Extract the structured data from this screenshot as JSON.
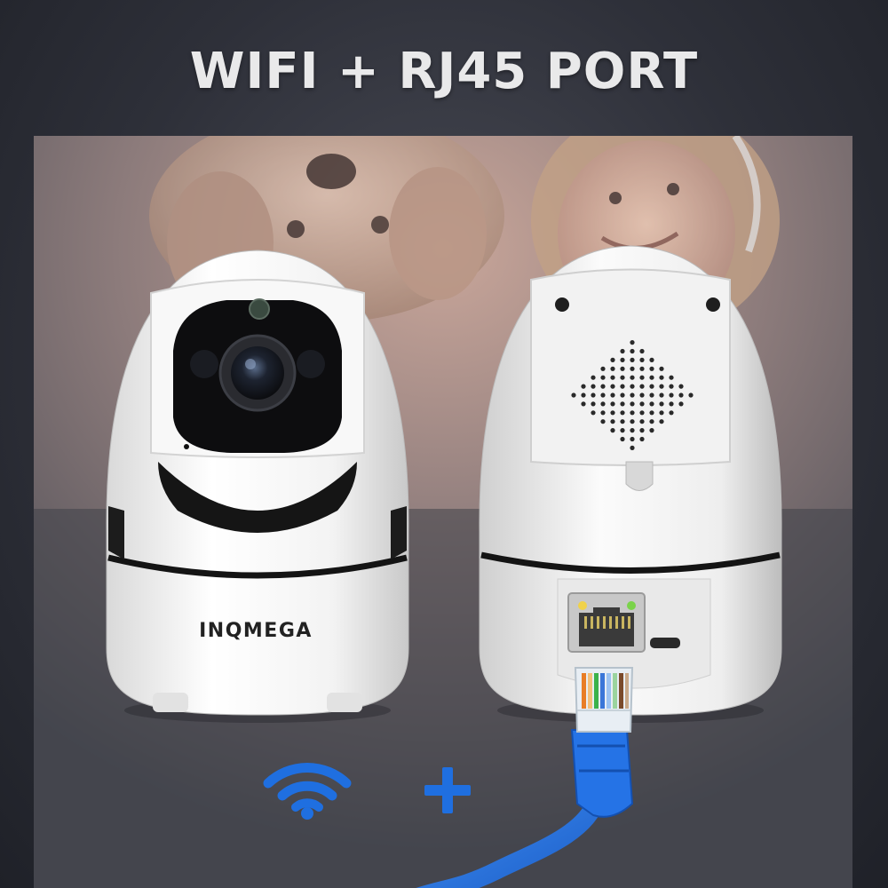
{
  "header": {
    "title": "WIFI  + RJ45 PORT"
  },
  "product": {
    "brand": "INQMEGA"
  },
  "icons": {
    "wifi": "wifi-icon",
    "plus": "plus-icon",
    "cable": "ethernet-cable-icon"
  },
  "colors": {
    "accent_blue": "#1f6fe0",
    "camera_white": "#f4f4f4",
    "title_text": "#e9e9ea"
  }
}
